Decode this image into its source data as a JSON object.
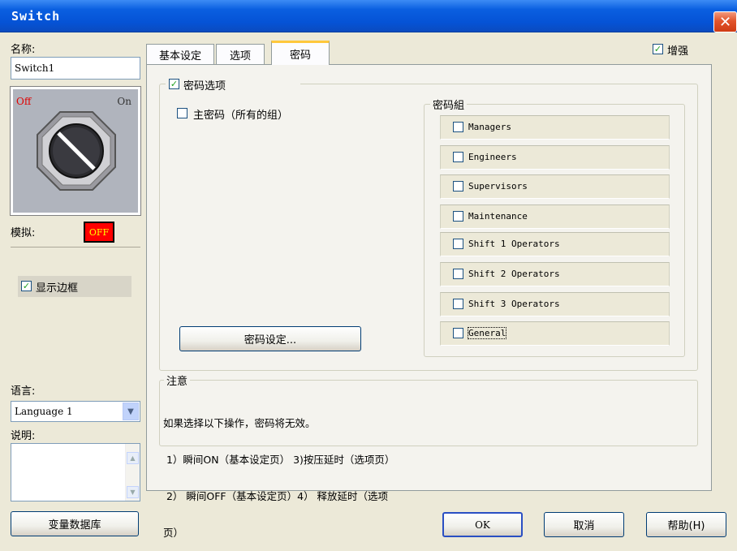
{
  "window": {
    "title": "Switch",
    "close_glyph": "✕"
  },
  "left": {
    "name_label": "名称:",
    "name_value": "Switch1",
    "preview": {
      "off_label": "Off",
      "on_label": "On"
    },
    "simulate_label": "模拟:",
    "simulate_value": "OFF",
    "show_border_label": "显示边框",
    "show_border_checked": true,
    "language_label": "语言:",
    "language_value": "Language 1",
    "description_label": "说明:"
  },
  "tabs": [
    {
      "label": "基本设定",
      "active": false
    },
    {
      "label": "选项",
      "active": false
    },
    {
      "label": "密码",
      "active": true
    }
  ],
  "enhance": {
    "label": "增强",
    "checked": true
  },
  "password_tab": {
    "password_option_label": "密码选项",
    "password_option_checked": true,
    "master_password_label": "主密码（所有的组）",
    "master_password_checked": false,
    "group_title": "密码組",
    "groups": [
      {
        "label": "Managers",
        "checked": false
      },
      {
        "label": "Engineers",
        "checked": false
      },
      {
        "label": "Supervisors",
        "checked": false
      },
      {
        "label": "Maintenance",
        "checked": false
      },
      {
        "label": "Shift 1 Operators",
        "checked": false
      },
      {
        "label": "Shift 2 Operators",
        "checked": false
      },
      {
        "label": "Shift 3 Operators",
        "checked": false
      },
      {
        "label": "General",
        "checked": false
      }
    ],
    "password_setup_button": "密码设定...",
    "note_title": "注意",
    "note_lines": [
      "如果选择以下操作，密码将无效。",
      " 1）瞬间ON（基本设定页） 3)按压延时（选项页）",
      " 2） 瞬间OFF（基本设定页）4） 释放延时（选项",
      "页）"
    ]
  },
  "bottom": {
    "tag_db_button": "变量数据库",
    "ok_button": "OK",
    "cancel_button": "取消",
    "help_button": "帮助(H)"
  },
  "colors": {
    "title_bar": "#0553d6",
    "dialog_bg": "#ece9d8",
    "active_tab_accent": "#ffc83c",
    "sim_off_bg": "#ff0000",
    "sim_off_text": "#ffff00"
  }
}
